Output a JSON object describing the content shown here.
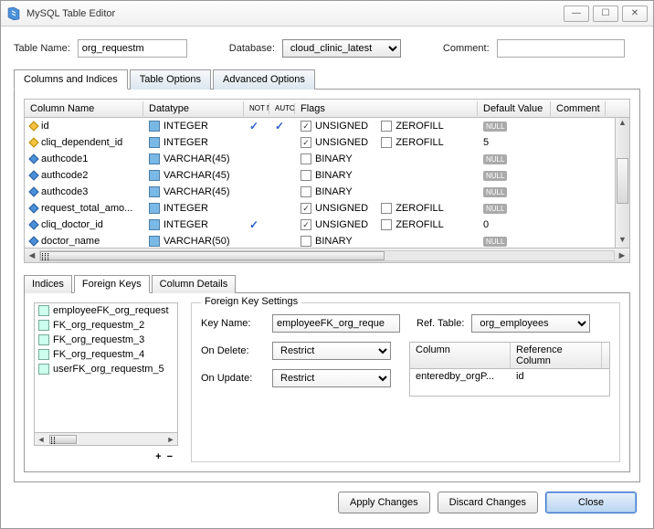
{
  "window": {
    "title": "MySQL Table Editor",
    "min": "—",
    "max": "☐",
    "close": "✕"
  },
  "top": {
    "table_name_label": "Table Name:",
    "table_name_value": "org_requestm",
    "database_label": "Database:",
    "database_value": "cloud_clinic_latest",
    "comment_label": "Comment:",
    "comment_value": ""
  },
  "tabs": {
    "columns": "Columns and Indices",
    "options": "Table Options",
    "advanced": "Advanced Options"
  },
  "grid": {
    "headers": {
      "name": "Column Name",
      "datatype": "Datatype",
      "notnull": "NOT NULL",
      "autoinc": "AUTO INC",
      "flags": "Flags",
      "default": "Default Value",
      "comment": "Comment"
    },
    "rows": [
      {
        "name": "id",
        "type": "INTEGER",
        "nn": true,
        "ai": true,
        "f1": {
          "label": "UNSIGNED",
          "checked": true
        },
        "f2": {
          "label": "ZEROFILL",
          "checked": false
        },
        "def": "NULL",
        "def_badge": true
      },
      {
        "name": "cliq_dependent_id",
        "type": "INTEGER",
        "nn": false,
        "ai": false,
        "f1": {
          "label": "UNSIGNED",
          "checked": true
        },
        "f2": {
          "label": "ZEROFILL",
          "checked": false
        },
        "def": "5",
        "def_badge": false
      },
      {
        "name": "authcode1",
        "type": "VARCHAR(45)",
        "nn": false,
        "ai": false,
        "f1": {
          "label": "BINARY",
          "checked": false
        },
        "f2": null,
        "def": "NULL",
        "def_badge": true
      },
      {
        "name": "authcode2",
        "type": "VARCHAR(45)",
        "nn": false,
        "ai": false,
        "f1": {
          "label": "BINARY",
          "checked": false
        },
        "f2": null,
        "def": "NULL",
        "def_badge": true
      },
      {
        "name": "authcode3",
        "type": "VARCHAR(45)",
        "nn": false,
        "ai": false,
        "f1": {
          "label": "BINARY",
          "checked": false
        },
        "f2": null,
        "def": "NULL",
        "def_badge": true
      },
      {
        "name": "request_total_amo...",
        "type": "INTEGER",
        "nn": false,
        "ai": false,
        "f1": {
          "label": "UNSIGNED",
          "checked": true
        },
        "f2": {
          "label": "ZEROFILL",
          "checked": false
        },
        "def": "NULL",
        "def_badge": true
      },
      {
        "name": "cliq_doctor_id",
        "type": "INTEGER",
        "nn": true,
        "ai": false,
        "f1": {
          "label": "UNSIGNED",
          "checked": true
        },
        "f2": {
          "label": "ZEROFILL",
          "checked": false
        },
        "def": "0",
        "def_badge": false
      },
      {
        "name": "doctor_name",
        "type": "VARCHAR(50)",
        "nn": false,
        "ai": false,
        "f1": {
          "label": "BINARY",
          "checked": false
        },
        "f2": null,
        "def": "NULL",
        "def_badge": true
      }
    ]
  },
  "subtabs": {
    "indices": "Indices",
    "fk": "Foreign Keys",
    "details": "Column Details"
  },
  "fk": {
    "list": [
      "employeeFK_org_request",
      "FK_org_requestm_2",
      "FK_org_requestm_3",
      "FK_org_requestm_4",
      "userFK_org_requestm_5"
    ],
    "plus": "+",
    "minus": "−",
    "settings_legend": "Foreign Key Settings",
    "key_name_label": "Key Name:",
    "key_name_value": "employeeFK_org_reque",
    "ref_table_label": "Ref. Table:",
    "ref_table_value": "org_employees",
    "on_delete_label": "On Delete:",
    "on_delete_value": "Restrict",
    "on_update_label": "On Update:",
    "on_update_value": "Restrict",
    "ref_head_col": "Column",
    "ref_head_ref": "Reference Column",
    "ref_col": "enteredby_orgP...",
    "ref_ref": "id"
  },
  "buttons": {
    "apply": "Apply Changes",
    "discard": "Discard Changes",
    "close": "Close"
  }
}
